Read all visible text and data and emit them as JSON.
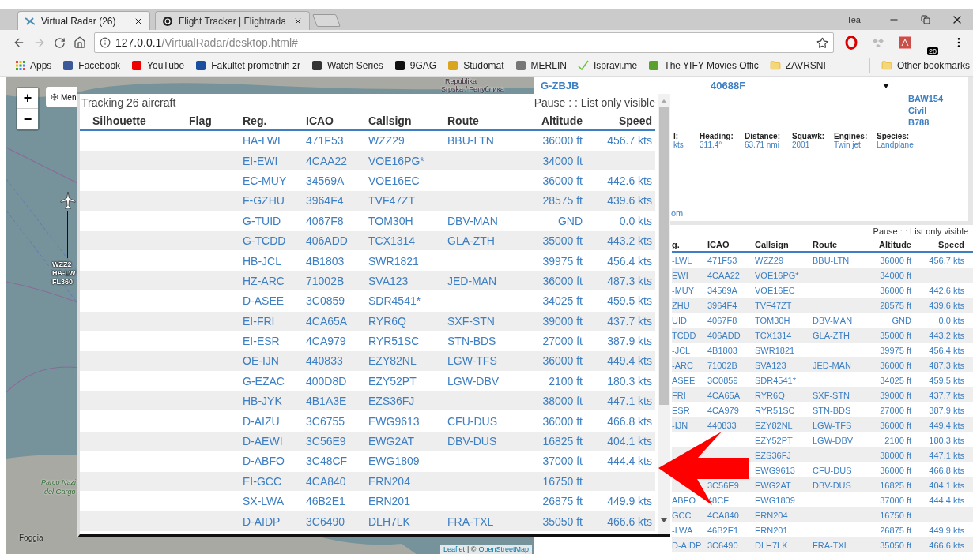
{
  "browser": {
    "tabs": [
      {
        "title": "Virtual Radar (26)",
        "selected": true
      },
      {
        "title": "Flight Tracker | Flightrada",
        "selected": false
      }
    ],
    "profile": "Tea",
    "address": {
      "host": "127.0.0.1",
      "path": "/VirtualRadar/desktop.html#"
    },
    "extension_badge": "20",
    "bookmarks": [
      "Apps",
      "Facebook",
      "YouTube",
      "Fakultet prometnih zr",
      "Watch Series",
      "9GAG",
      "Studomat",
      "MERLIN",
      "Ispravi.me",
      "The YIFY Movies Offic",
      "ZAVRSNI"
    ],
    "other_bookmarks": "Other bookmarks"
  },
  "map": {
    "zoom_in": "+",
    "zoom_out": "−",
    "menu_button": "Men",
    "labels": [
      {
        "text": "Republika",
        "kind": "country"
      },
      {
        "text": "Srpska / Република",
        "kind": "country"
      },
      {
        "text": "Parco Nazi",
        "kind": "park"
      },
      {
        "text": "del Gargo",
        "kind": "park"
      },
      {
        "text": "Foggia",
        "kind": "city"
      }
    ],
    "aircraft_label": [
      "WZZ2",
      "HA-LW",
      "FL360"
    ],
    "attribution": {
      "leaflet": "Leaflet",
      "separator": "| ©",
      "osm": "OpenStreetMap"
    }
  },
  "aircraft_list": {
    "title": "Tracking 26 aircraft",
    "options": "Pause : : List only visible",
    "columns": [
      "Silhouette",
      "Flag",
      "Reg.",
      "ICAO",
      "Callsign",
      "Route",
      "Altitude",
      "Speed"
    ],
    "rows": [
      {
        "reg": "HA-LWL",
        "icao": "471F53",
        "callsign": "WZZ29",
        "route": "BBU-LTN",
        "altitude": "36000 ft",
        "speed": "456.7 kts"
      },
      {
        "reg": "EI-EWI",
        "icao": "4CAA22",
        "callsign": "VOE16PG*",
        "altitude": "34000 ft"
      },
      {
        "reg": "EC-MUY",
        "icao": "34569A",
        "callsign": "VOE16EC",
        "altitude": "36000 ft",
        "speed": "442.6 kts"
      },
      {
        "reg": "F-GZHU",
        "icao": "3964F4",
        "callsign": "TVF47ZT",
        "altitude": "28575 ft",
        "speed": "439.6 kts"
      },
      {
        "reg": "G-TUID",
        "icao": "4067F8",
        "callsign": "TOM30H",
        "route": "DBV-MAN",
        "altitude": "GND",
        "speed": "0.0 kts"
      },
      {
        "reg": "G-TCDD",
        "icao": "406ADD",
        "callsign": "TCX1314",
        "route": "GLA-ZTH",
        "altitude": "35000 ft",
        "speed": "443.2 kts"
      },
      {
        "reg": "HB-JCL",
        "icao": "4B1803",
        "callsign": "SWR1821",
        "altitude": "39975 ft",
        "speed": "456.4 kts"
      },
      {
        "reg": "HZ-ARC",
        "icao": "71002B",
        "callsign": "SVA123",
        "route": "JED-MAN",
        "altitude": "36000 ft",
        "speed": "487.3 kts"
      },
      {
        "reg": "D-ASEE",
        "icao": "3C0859",
        "callsign": "SDR4541*",
        "altitude": "34025 ft",
        "speed": "459.5 kts"
      },
      {
        "reg": "EI-FRI",
        "icao": "4CA65A",
        "callsign": "RYR6Q",
        "route": "SXF-STN",
        "altitude": "39000 ft",
        "speed": "437.7 kts"
      },
      {
        "reg": "EI-ESR",
        "icao": "4CA979",
        "callsign": "RYR51SC",
        "route": "STN-BDS",
        "altitude": "27000 ft",
        "speed": "387.9 kts"
      },
      {
        "reg": "OE-IJN",
        "icao": "440833",
        "callsign": "EZY82NL",
        "route": "LGW-TFS",
        "altitude": "36000 ft",
        "speed": "449.4 kts"
      },
      {
        "reg": "G-EZAC",
        "icao": "400D8D",
        "callsign": "EZY52PT",
        "route": "LGW-DBV",
        "altitude": "2100 ft",
        "speed": "180.3 kts"
      },
      {
        "reg": "HB-JYK",
        "icao": "4B1A3E",
        "callsign": "EZS36FJ",
        "altitude": "38000 ft",
        "speed": "447.1 kts"
      },
      {
        "reg": "D-AIZU",
        "icao": "3C6755",
        "callsign": "EWG9613",
        "route": "CFU-DUS",
        "altitude": "36000 ft",
        "speed": "466.8 kts"
      },
      {
        "reg": "D-AEWI",
        "icao": "3C56E9",
        "callsign": "EWG2AT",
        "route": "DBV-DUS",
        "altitude": "16825 ft",
        "speed": "404.1 kts"
      },
      {
        "reg": "D-ABFO",
        "icao": "3C48CF",
        "callsign": "EWG1809",
        "altitude": "37000 ft",
        "speed": "444.4 kts"
      },
      {
        "reg": "EI-GCC",
        "icao": "4CA840",
        "callsign": "ERN204",
        "altitude": "16750 ft"
      },
      {
        "reg": "SX-LWA",
        "icao": "46B2E1",
        "callsign": "ERN201",
        "altitude": "26875 ft",
        "speed": "449.9 kts"
      },
      {
        "reg": "D-AIDP",
        "icao": "3C6490",
        "callsign": "DLH7LK",
        "route": "FRA-TXL",
        "altitude": "35050 ft",
        "speed": "466.6 kts"
      }
    ]
  },
  "details": {
    "registration": "G-ZBJB",
    "icao": "40688F",
    "callsign": "BAW154",
    "category": "Civil",
    "model": "B788",
    "fields": [
      {
        "label": "l:",
        "value": "kts"
      },
      {
        "label": "Heading:",
        "value": "311.4°"
      },
      {
        "label": "Distance:",
        "value": "63.71 nmi"
      },
      {
        "label": "Squawk:",
        "value": "2001"
      },
      {
        "label": "Engines:",
        "value": "Twin jet"
      },
      {
        "label": "Species:",
        "value": "Landplane"
      }
    ],
    "link_fragment": "om"
  },
  "side_list": {
    "options": "Pause : : List only visible",
    "columns": [
      "g.",
      "ICAO",
      "Callsign",
      "Route",
      "Altitude",
      "Speed"
    ],
    "rows": [
      {
        "reg": "-LWL",
        "icao": "471F53",
        "callsign": "WZZ29",
        "route": "BBU-LTN",
        "altitude": "36000 ft",
        "speed": "456.7 kts"
      },
      {
        "reg": "EWI",
        "icao": "4CAA22",
        "callsign": "VOE16PG*",
        "altitude": "34000 ft"
      },
      {
        "reg": "-MUY",
        "icao": "34569A",
        "callsign": "VOE16EC",
        "altitude": "36000 ft",
        "speed": "442.6 kts"
      },
      {
        "reg": "ZHU",
        "icao": "3964F4",
        "callsign": "TVF47ZT",
        "altitude": "28575 ft",
        "speed": "439.6 kts"
      },
      {
        "reg": "UID",
        "icao": "4067F8",
        "callsign": "TOM30H",
        "route": "DBV-MAN",
        "altitude": "GND",
        "speed": "0.0 kts"
      },
      {
        "reg": "TCDD",
        "icao": "406ADD",
        "callsign": "TCX1314",
        "route": "GLA-ZTH",
        "altitude": "35000 ft",
        "speed": "443.2 kts"
      },
      {
        "reg": "-JCL",
        "icao": "4B1803",
        "callsign": "SWR1821",
        "altitude": "39975 ft",
        "speed": "456.4 kts"
      },
      {
        "reg": "-ARC",
        "icao": "71002B",
        "callsign": "SVA123",
        "route": "JED-MAN",
        "altitude": "36000 ft",
        "speed": "487.3 kts"
      },
      {
        "reg": "ASEE",
        "icao": "3C0859",
        "callsign": "SDR4541*",
        "altitude": "34025 ft",
        "speed": "459.5 kts"
      },
      {
        "reg": "FRI",
        "icao": "4CA65A",
        "callsign": "RYR6Q",
        "route": "SXF-STN",
        "altitude": "39000 ft",
        "speed": "437.7 kts"
      },
      {
        "reg": "ESR",
        "icao": "4CA979",
        "callsign": "RYR51SC",
        "route": "STN-BDS",
        "altitude": "27000 ft",
        "speed": "387.9 kts"
      },
      {
        "reg": "-IJN",
        "icao": "440833",
        "callsign": "EZY82NL",
        "route": "LGW-TFS",
        "altitude": "36000 ft",
        "speed": "449.4 kts"
      },
      {
        "callsign": "EZY52PT",
        "route": "LGW-DBV",
        "altitude": "2100 ft",
        "speed": "180.3 kts"
      },
      {
        "callsign": "EZS36FJ",
        "altitude": "38000 ft",
        "speed": "447.1 kts"
      },
      {
        "callsign": "EWG9613",
        "route": "CFU-DUS",
        "altitude": "36000 ft",
        "speed": "466.8 kts"
      },
      {
        "icao": "3C56E9",
        "callsign": "EWG2AT",
        "route": "DBV-DUS",
        "altitude": "16825 ft",
        "speed": "404.1 kts"
      },
      {
        "reg": "ABFO",
        "icao": "48CF",
        "callsign": "EWG1809",
        "altitude": "37000 ft",
        "speed": "444.4 kts"
      },
      {
        "reg": "GCC",
        "icao": "4CA840",
        "callsign": "ERN204",
        "altitude": "16750 ft"
      },
      {
        "reg": "-LWA",
        "icao": "46B2E1",
        "callsign": "ERN201",
        "altitude": "26875 ft",
        "speed": "449.9 kts"
      },
      {
        "reg": "D-AIDP",
        "icao": "3C6490",
        "callsign": "DLH7LK",
        "route": "FRA-TXL",
        "altitude": "35050 ft",
        "speed": "466.6 kts"
      }
    ]
  }
}
